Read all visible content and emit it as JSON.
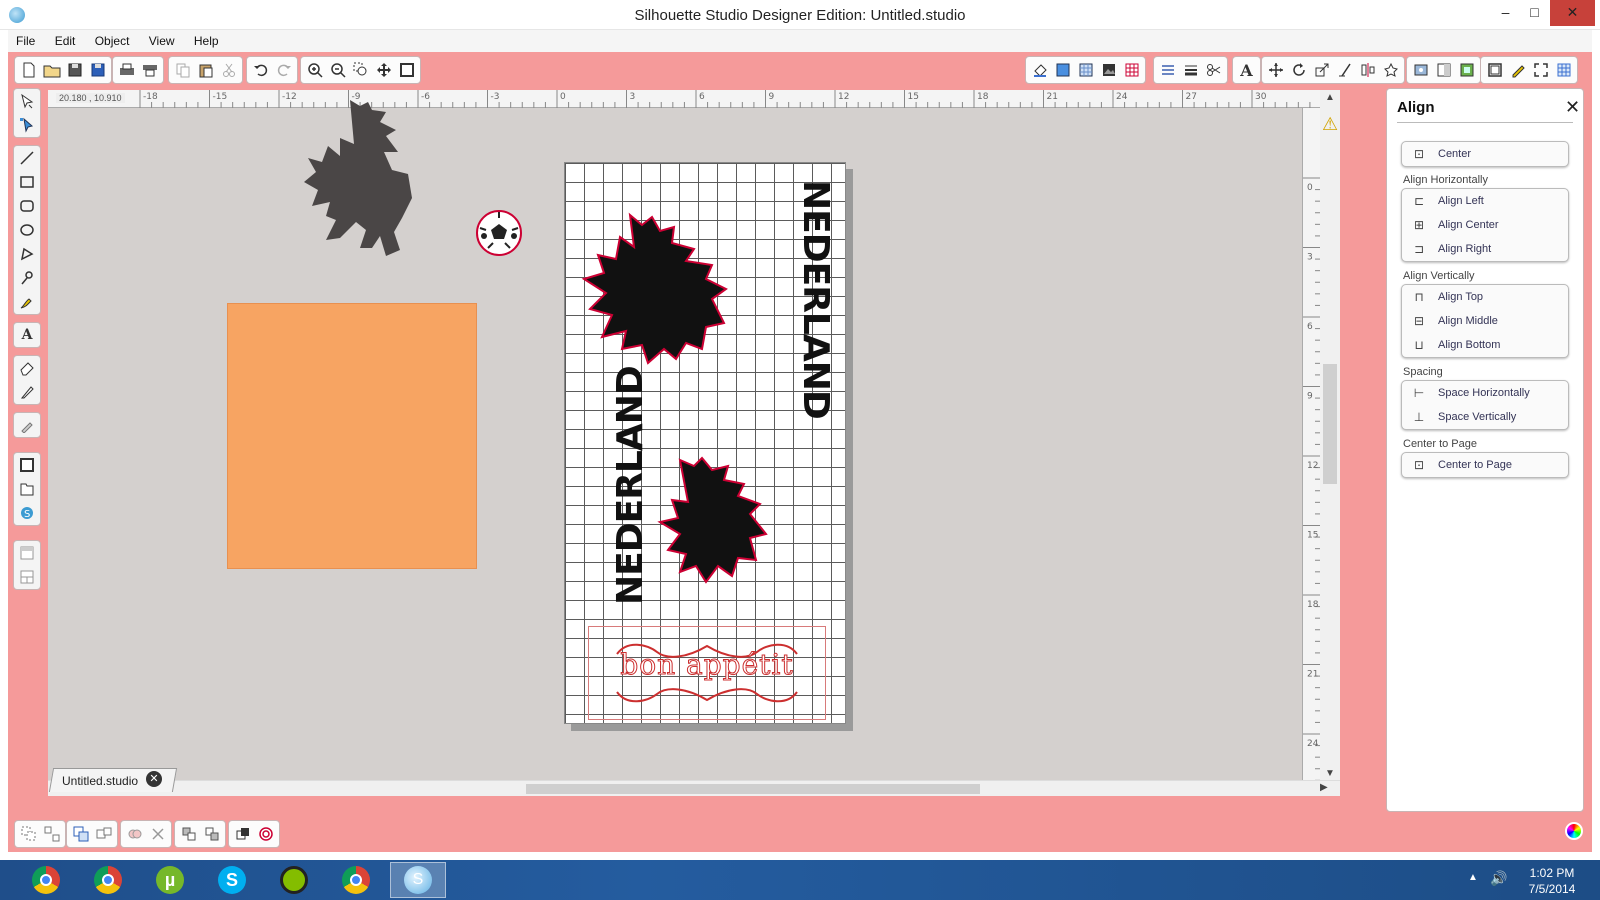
{
  "window": {
    "title": "Silhouette Studio Designer Edition: Untitled.studio",
    "minimize": "–",
    "maximize": "□",
    "close": "✕"
  },
  "menu": [
    "File",
    "Edit",
    "Object",
    "View",
    "Help"
  ],
  "canvas": {
    "coordinates": "20.180 , 10.910",
    "ruler_top": [
      "-18",
      "-15",
      "-12",
      "-9",
      "-6",
      "-3",
      "0",
      "3",
      "6",
      "9",
      "12",
      "15",
      "18",
      "21",
      "24",
      "27",
      "30"
    ],
    "ruler_left": [
      "0",
      "3",
      "6",
      "9",
      "12",
      "15",
      "18",
      "21",
      "24"
    ],
    "page": {
      "text_top": "NEDERLAND",
      "text_bottom": "NEDERLAND",
      "stamp": "bon appétit"
    }
  },
  "document_tab": {
    "label": "Untitled.studio",
    "close": "✕"
  },
  "align_panel": {
    "title": "Align",
    "close": "✕",
    "center_label": "Center",
    "sections": [
      {
        "label": "Align Horizontally",
        "buttons": [
          "Align Left",
          "Align Center",
          "Align Right"
        ]
      },
      {
        "label": "Align Vertically",
        "buttons": [
          "Align Top",
          "Align Middle",
          "Align Bottom"
        ]
      },
      {
        "label": "Spacing",
        "buttons": [
          "Space Horizontally",
          "Space Vertically"
        ]
      },
      {
        "label": "Center to Page",
        "buttons": [
          "Center to Page"
        ]
      }
    ]
  },
  "colors": {
    "frame": "#f59a9a",
    "canvas": "#d4d0ce",
    "orange_rect": "#f7a462",
    "cut_line": "#cc2f2f",
    "taskbar": "#245c9f"
  },
  "taskbar": {
    "apps": [
      "chrome-icon",
      "chrome-icon",
      "utorrent-icon",
      "skype-icon",
      "spotify-icon",
      "chrome-icon",
      "silhouette-icon"
    ],
    "utorrent_glyph": "µ",
    "skype_glyph": "S",
    "silhouette_glyph": "S",
    "clock_time": "1:02 PM",
    "clock_date": "7/5/2014"
  }
}
